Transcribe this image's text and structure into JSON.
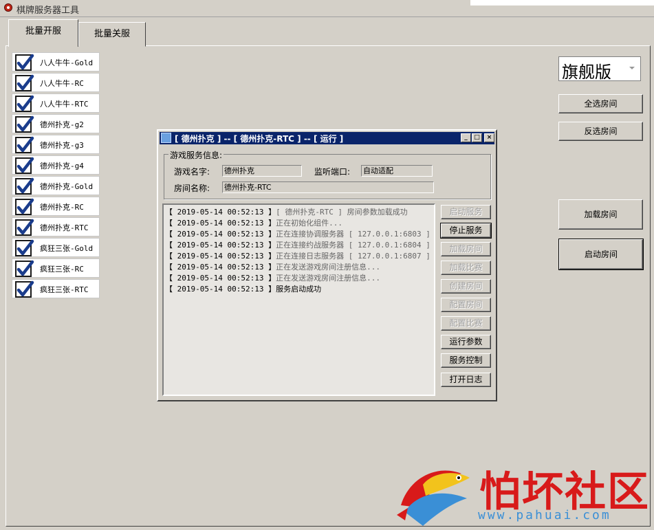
{
  "window": {
    "title": "棋牌服务器工具"
  },
  "tabs": [
    {
      "label": "批量开服"
    },
    {
      "label": "批量关服"
    }
  ],
  "rooms": [
    {
      "label": "八人牛牛-Gold",
      "checked": true
    },
    {
      "label": "八人牛牛-RC",
      "checked": true
    },
    {
      "label": "八人牛牛-RTC",
      "checked": true
    },
    {
      "label": "德州扑克-g2",
      "checked": true
    },
    {
      "label": "德州扑克-g3",
      "checked": true
    },
    {
      "label": "德州扑克-g4",
      "checked": true
    },
    {
      "label": "德州扑克-Gold",
      "checked": true
    },
    {
      "label": "德州扑克-RC",
      "checked": true
    },
    {
      "label": "德州扑克-RTC",
      "checked": true
    },
    {
      "label": "疯狂三张-Gold",
      "checked": true
    },
    {
      "label": "疯狂三张-RC",
      "checked": true
    },
    {
      "label": "疯狂三张-RTC",
      "checked": true
    }
  ],
  "edition": {
    "value": "旗舰版"
  },
  "right_buttons": {
    "select_all": "全选房间",
    "invert_select": "反选房间",
    "load_rooms": "加载房间",
    "start_rooms": "启动房间"
  },
  "dialog": {
    "title": "[ 德州扑克 ] -- [ 德州扑克-RTC ] -- [ 运行 ]",
    "window_buttons": {
      "minimize": "_",
      "maximize": "□",
      "close": "×"
    },
    "group_title": "游戏服务信息:",
    "game_name_label": "游戏名字:",
    "game_name_value": "德州扑克",
    "port_label": "监听端口:",
    "port_value": "自动适配",
    "room_name_label": "房间名称:",
    "room_name_value": "德州扑克-RTC",
    "log": [
      {
        "ts": "【 2019-05-14 00:52:13 】",
        "msg": "[ 德州扑克-RTC ] 房间参数加载成功",
        "dark": false
      },
      {
        "ts": "【 2019-05-14 00:52:13 】",
        "msg": "正在初始化组件...",
        "dark": false
      },
      {
        "ts": "【 2019-05-14 00:52:13 】",
        "msg": "正在连接协调服务器 [ 127.0.0.1:6803 ]",
        "dark": false
      },
      {
        "ts": "【 2019-05-14 00:52:13 】",
        "msg": "正在连接约战服务器 [ 127.0.0.1:6804 ]",
        "dark": false
      },
      {
        "ts": "【 2019-05-14 00:52:13 】",
        "msg": "正在连接日志服务器 [ 127.0.0.1:6807 ]",
        "dark": false
      },
      {
        "ts": "【 2019-05-14 00:52:13 】",
        "msg": "正在发送游戏房间注册信息...",
        "dark": false
      },
      {
        "ts": "【 2019-05-14 00:52:13 】",
        "msg": "正在发送游戏房间注册信息...",
        "dark": false
      },
      {
        "ts": "【 2019-05-14 00:52:13 】",
        "msg": "服务启动成功",
        "dark": true
      }
    ],
    "side_buttons": [
      {
        "label": "启动服务",
        "enabled": false
      },
      {
        "label": "停止服务",
        "enabled": true
      },
      {
        "label": "加载房间",
        "enabled": false
      },
      {
        "label": "加载比赛",
        "enabled": false
      },
      {
        "label": "创建房间",
        "enabled": false
      },
      {
        "label": "配置房间",
        "enabled": false
      },
      {
        "label": "配置比赛",
        "enabled": false
      },
      {
        "label": "运行参数",
        "enabled": true
      },
      {
        "label": "服务控制",
        "enabled": true
      },
      {
        "label": "打开日志",
        "enabled": true
      }
    ]
  },
  "watermark": {
    "text": "怕坏社区",
    "url": "www.pahuai.com"
  },
  "colors": {
    "dialog_title_bg": "#0a246a",
    "window_bg": "#d4d0c8",
    "watermark_red": "#d81a1a",
    "watermark_blue": "#3a8fd6"
  }
}
